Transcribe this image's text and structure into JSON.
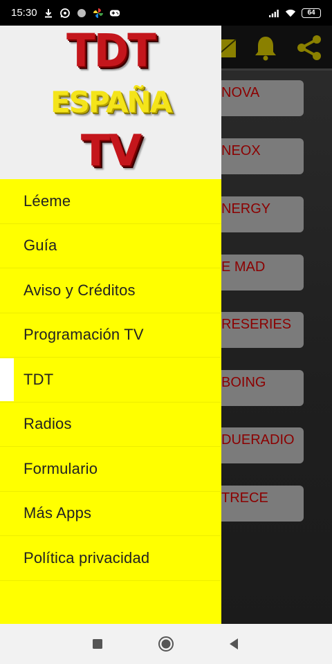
{
  "status": {
    "time": "15:30",
    "battery": "64",
    "icons_left": [
      "download-icon",
      "whatsapp-icon",
      "circle-icon",
      "pinwheel-icon",
      "gamepad-icon"
    ],
    "icons_right": [
      "signal-icon",
      "wifi-icon",
      "battery-icon"
    ]
  },
  "drawer": {
    "logo": {
      "line1": "TDT",
      "line2": "ESPAÑA",
      "line3": "TV"
    },
    "items": [
      {
        "label": "Léeme",
        "selected": false
      },
      {
        "label": "Guía",
        "selected": false
      },
      {
        "label": "Aviso y Créditos",
        "selected": false
      },
      {
        "label": "Programación TV",
        "selected": false
      },
      {
        "label": "TDT",
        "selected": true
      },
      {
        "label": "Radios",
        "selected": false
      },
      {
        "label": "Formulario",
        "selected": false
      },
      {
        "label": "Más Apps",
        "selected": false
      },
      {
        "label": "Política privacidad",
        "selected": false
      }
    ]
  },
  "background": {
    "toolbar_icons": [
      "broadcast-icon",
      "bell-icon",
      "share-icon"
    ],
    "channels": [
      "NOVA",
      "NEOX",
      "NERGY",
      "E MAD",
      "RESERIES",
      "BOING",
      "DUERADIO",
      "TRECE"
    ]
  },
  "navbar": {
    "buttons": [
      "recents-button",
      "home-button",
      "back-button"
    ]
  },
  "colors": {
    "drawer_bg": "#ffff00",
    "header_bg": "#efefef",
    "channel_text": "#8b0000",
    "channel_btn": "#7b7b7b",
    "toolbar_icon": "#8a8000"
  }
}
